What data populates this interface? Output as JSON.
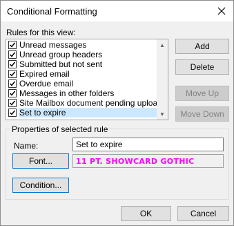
{
  "window": {
    "title": "Conditional Formatting"
  },
  "rules": {
    "label": "Rules for this view:",
    "items": [
      {
        "label": "Unread messages",
        "checked": true
      },
      {
        "label": "Unread group headers",
        "checked": true
      },
      {
        "label": "Submitted but not sent",
        "checked": true
      },
      {
        "label": "Expired email",
        "checked": true
      },
      {
        "label": "Overdue email",
        "checked": true
      },
      {
        "label": "Messages in other folders",
        "checked": true
      },
      {
        "label": "Site Mailbox document pending uploa",
        "checked": true
      },
      {
        "label": "Set to expire",
        "checked": true,
        "selected": true
      }
    ]
  },
  "buttons": {
    "add": "Add",
    "delete": "Delete",
    "move_up": "Move Up",
    "move_down": "Move Down",
    "ok": "OK",
    "cancel": "Cancel"
  },
  "properties": {
    "title": "Properties of selected rule",
    "name_label": "Name:",
    "name_value": "Set to expire",
    "font_button": "Font...",
    "font_sample": "11 PT. SHOWCARD GOTHIC",
    "condition_button": "Condition..."
  },
  "colors": {
    "font_sample": "#ff00ff",
    "selection": "#cce8ff",
    "focus_border": "#0078d7"
  }
}
